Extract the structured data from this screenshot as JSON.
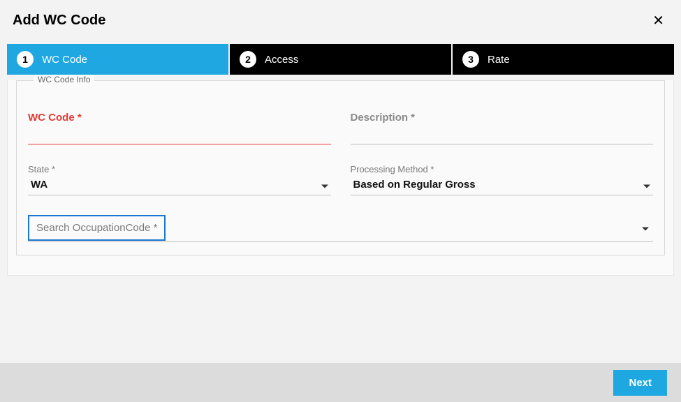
{
  "header": {
    "title": "Add WC Code"
  },
  "steps": [
    {
      "number": "1",
      "label": "WC Code",
      "active": true
    },
    {
      "number": "2",
      "label": "Access",
      "active": false
    },
    {
      "number": "3",
      "label": "Rate",
      "active": false
    }
  ],
  "fieldset": {
    "legend": "WC Code Info"
  },
  "fields": {
    "wc_code": {
      "label": "WC Code *",
      "value": ""
    },
    "description": {
      "label": "Description *",
      "value": ""
    },
    "state": {
      "label": "State *",
      "value": "WA"
    },
    "processing_method": {
      "label": "Processing Method *",
      "value": "Based on Regular Gross"
    },
    "occupation": {
      "placeholder": "Search OccupationCode *",
      "value": ""
    }
  },
  "footer": {
    "next": "Next"
  }
}
